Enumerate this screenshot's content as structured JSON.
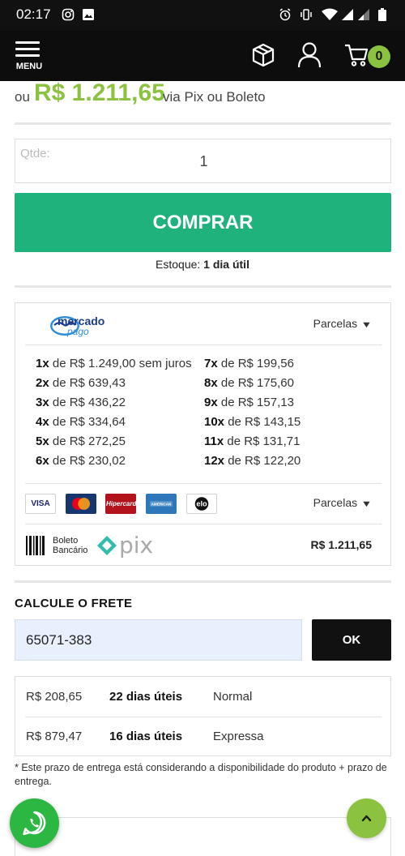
{
  "status_bar": {
    "time": "02:17"
  },
  "header": {
    "menu_label": "MENU",
    "cart_count": "0"
  },
  "price": {
    "prefix": "ou",
    "amount": "R$ 1.211,65",
    "suffix": "via Pix ou Boleto"
  },
  "quantity": {
    "label": "Qtde:",
    "value": "1"
  },
  "buy_button": "COMPRAR",
  "stock": {
    "label": "Estoque:",
    "value": "1 dia útil"
  },
  "payment": {
    "mp_logo_text": [
      "mercado",
      "pago"
    ],
    "installments_toggle": "Parcelas",
    "installments": [
      {
        "n": "1x",
        "text": "de R$ 1.249,00 sem juros"
      },
      {
        "n": "2x",
        "text": "de R$ 639,43"
      },
      {
        "n": "3x",
        "text": "de R$ 436,22"
      },
      {
        "n": "4x",
        "text": "de R$ 334,64"
      },
      {
        "n": "5x",
        "text": "de R$ 272,25"
      },
      {
        "n": "6x",
        "text": "de R$ 230,02"
      },
      {
        "n": "7x",
        "text": "de R$ 199,56"
      },
      {
        "n": "8x",
        "text": "de R$ 175,60"
      },
      {
        "n": "9x",
        "text": "de R$ 157,13"
      },
      {
        "n": "10x",
        "text": "de R$ 143,15"
      },
      {
        "n": "11x",
        "text": "de R$ 131,71"
      },
      {
        "n": "12x",
        "text": "de R$ 122,20"
      }
    ],
    "cards": [
      "VISA",
      "Mastercard",
      "Hipercard",
      "American Express",
      "elo"
    ],
    "cards_toggle": "Parcelas",
    "boleto_label": [
      "Boleto",
      "Bancário"
    ],
    "pix_label": "pix",
    "boleto_total": "R$ 1.211,65"
  },
  "shipping": {
    "title": "CALCULE O FRETE",
    "cep_value": "65071-383",
    "ok_label": "OK",
    "options": [
      {
        "price": "R$ 208,65",
        "days": "22 dias úteis",
        "method": "Normal"
      },
      {
        "price": "R$ 879,47",
        "days": "16 dias úteis",
        "method": "Expressa"
      }
    ],
    "note": "* Este prazo de entrega está considerando a disponibilidade do produto + prazo de entrega."
  },
  "colors": {
    "brand_green": "#8bc23f",
    "buy_green": "#1fb27d",
    "whatsapp_green": "#2bb741",
    "header_black": "#0d0d0d"
  }
}
